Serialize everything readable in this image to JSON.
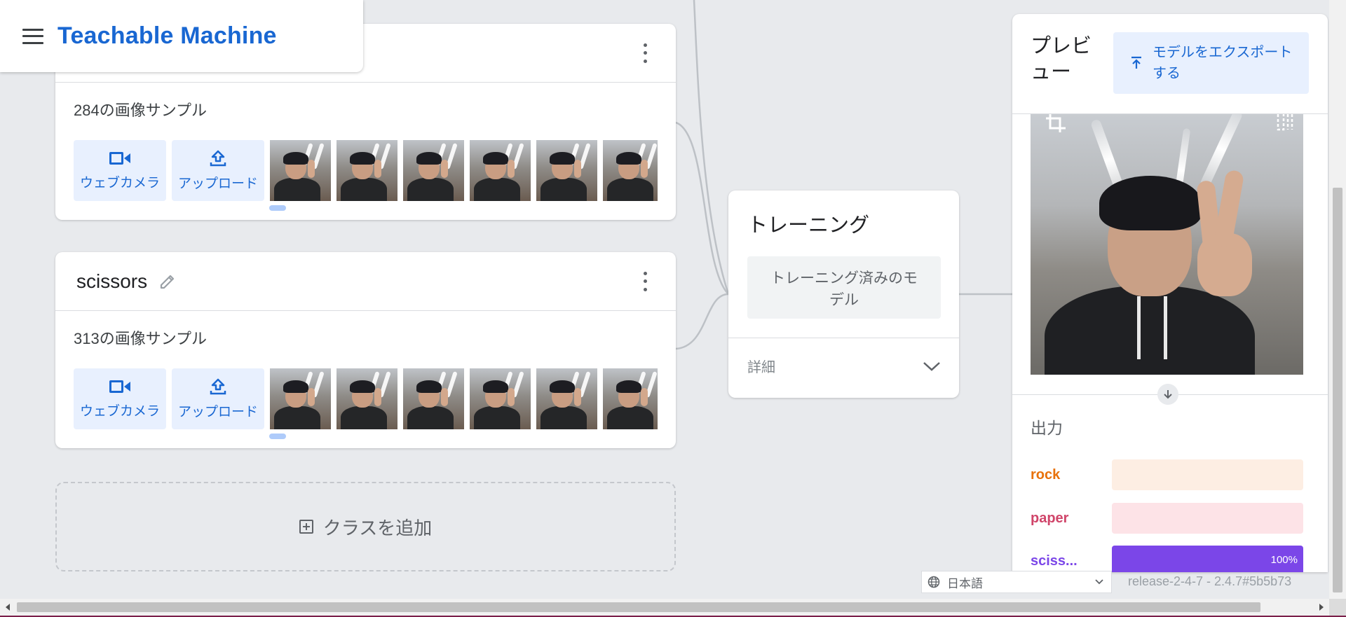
{
  "header": {
    "title": "Teachable Machine",
    "menu_icon": "menu-icon"
  },
  "classes": [
    {
      "name": "",
      "sample_count": "284の画像サンプル",
      "webcam_label": "ウェブカメラ",
      "upload_label": "アップロード"
    },
    {
      "name": "scissors",
      "sample_count": "313の画像サンプル",
      "webcam_label": "ウェブカメラ",
      "upload_label": "アップロード"
    }
  ],
  "add_class": {
    "label": "クラスを追加"
  },
  "training": {
    "title": "トレーニング",
    "button_label": "トレーニング済みのモデル",
    "details_label": "詳細"
  },
  "preview": {
    "title": "プレビュー",
    "export_label": "モデルをエクスポートする",
    "output_title": "出力",
    "outputs": [
      {
        "label": "rock",
        "percent": 0,
        "percent_text": "",
        "color": "#e8710a",
        "bg": "#fdeee3"
      },
      {
        "label": "paper",
        "percent": 0,
        "percent_text": "",
        "color": "#d0456a",
        "bg": "#fde3e7"
      },
      {
        "label": "sciss...",
        "percent": 100,
        "percent_text": "100%",
        "color": "#7b46e8",
        "bg": "#7b46e8"
      }
    ]
  },
  "footer": {
    "language": "日本語",
    "version": "release-2-4-7 - 2.4.7#5b5b73"
  },
  "colors": {
    "accent": "#1967d2",
    "background": "#e8eaed"
  }
}
